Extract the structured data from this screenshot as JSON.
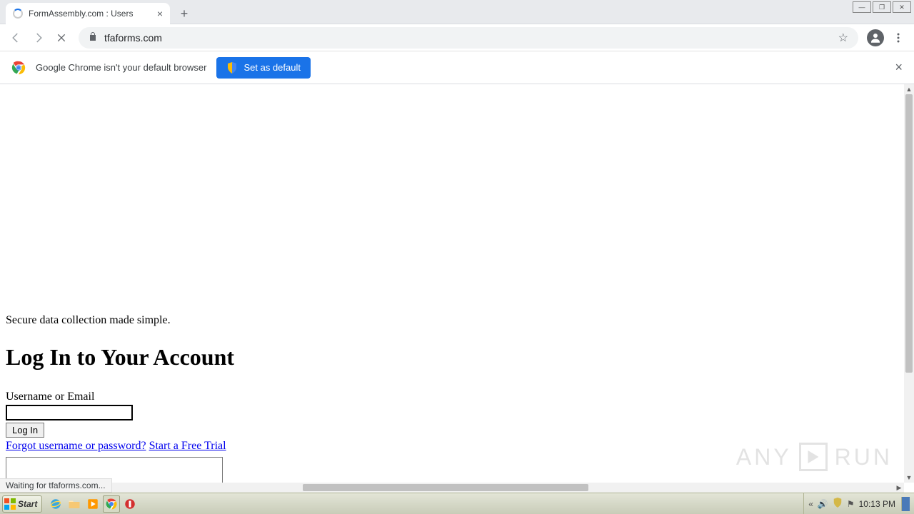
{
  "browser": {
    "tab_title": "FormAssembly.com : Users",
    "url": "tfaforms.com",
    "infobar_text": "Google Chrome isn't your default browser",
    "set_default_label": "Set as default",
    "status_text": "Waiting for tfaforms.com..."
  },
  "page": {
    "tagline": "Secure data collection made simple.",
    "heading": "Log In to Your Account",
    "username_label": "Username or Email",
    "login_button": "Log In",
    "forgot_link": "Forgot username or password?",
    "trial_link": "Start a Free Trial"
  },
  "taskbar": {
    "start_label": "Start",
    "clock": "10:13 PM"
  },
  "watermark": {
    "left": "ANY",
    "right": "RUN"
  }
}
